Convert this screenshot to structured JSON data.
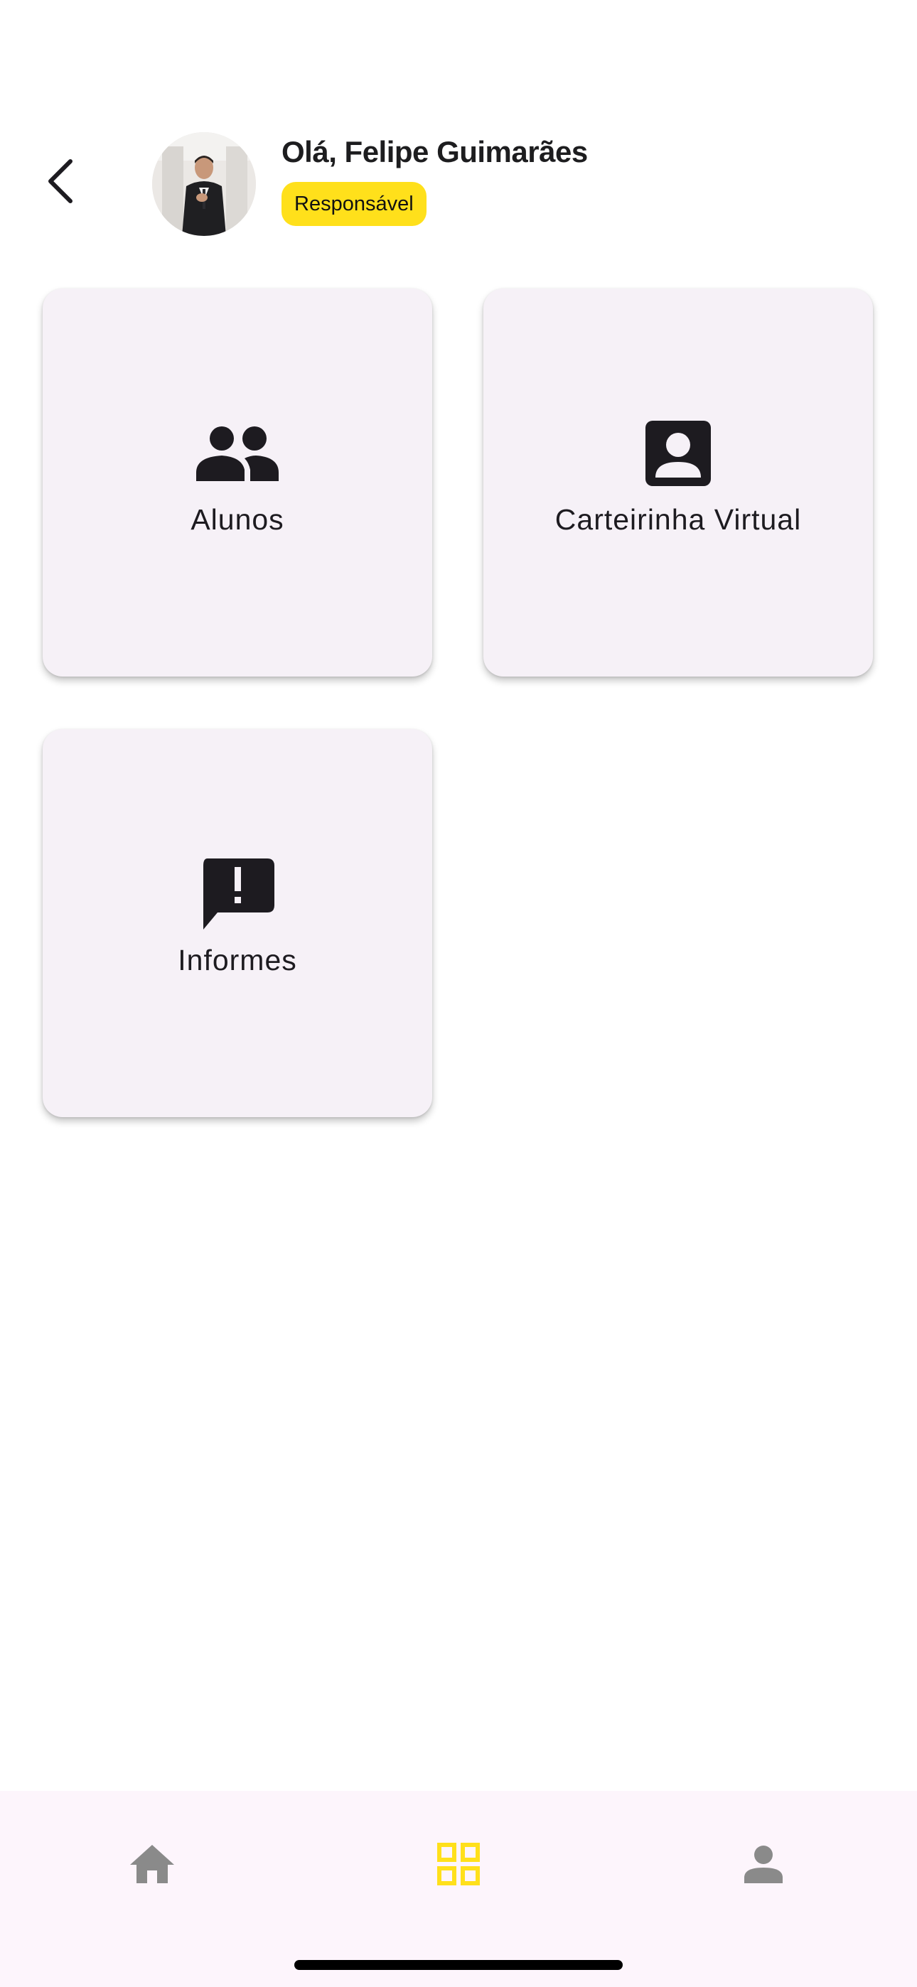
{
  "header": {
    "greeting": "Olá, Felipe Guimarães",
    "role_badge": "Responsável",
    "back_icon": "chevron-left-icon",
    "avatar": "user-photo"
  },
  "cards": [
    {
      "label": "Alunos",
      "icon": "people-icon"
    },
    {
      "label": "Carteirinha Virtual",
      "icon": "account-box-icon"
    },
    {
      "label": "Informes",
      "icon": "announcement-icon"
    }
  ],
  "bottom_nav": {
    "items": [
      {
        "icon": "home-icon",
        "active": false
      },
      {
        "icon": "grid-view-icon",
        "active": true
      },
      {
        "icon": "person-icon",
        "active": false
      }
    ]
  },
  "colors": {
    "accent": "#FFE01B",
    "card_bg": "#F6F1F7",
    "icon_dark": "#1D1B20",
    "nav_inactive": "#8A8A8A",
    "nav_bg": "#FDF5FC"
  }
}
